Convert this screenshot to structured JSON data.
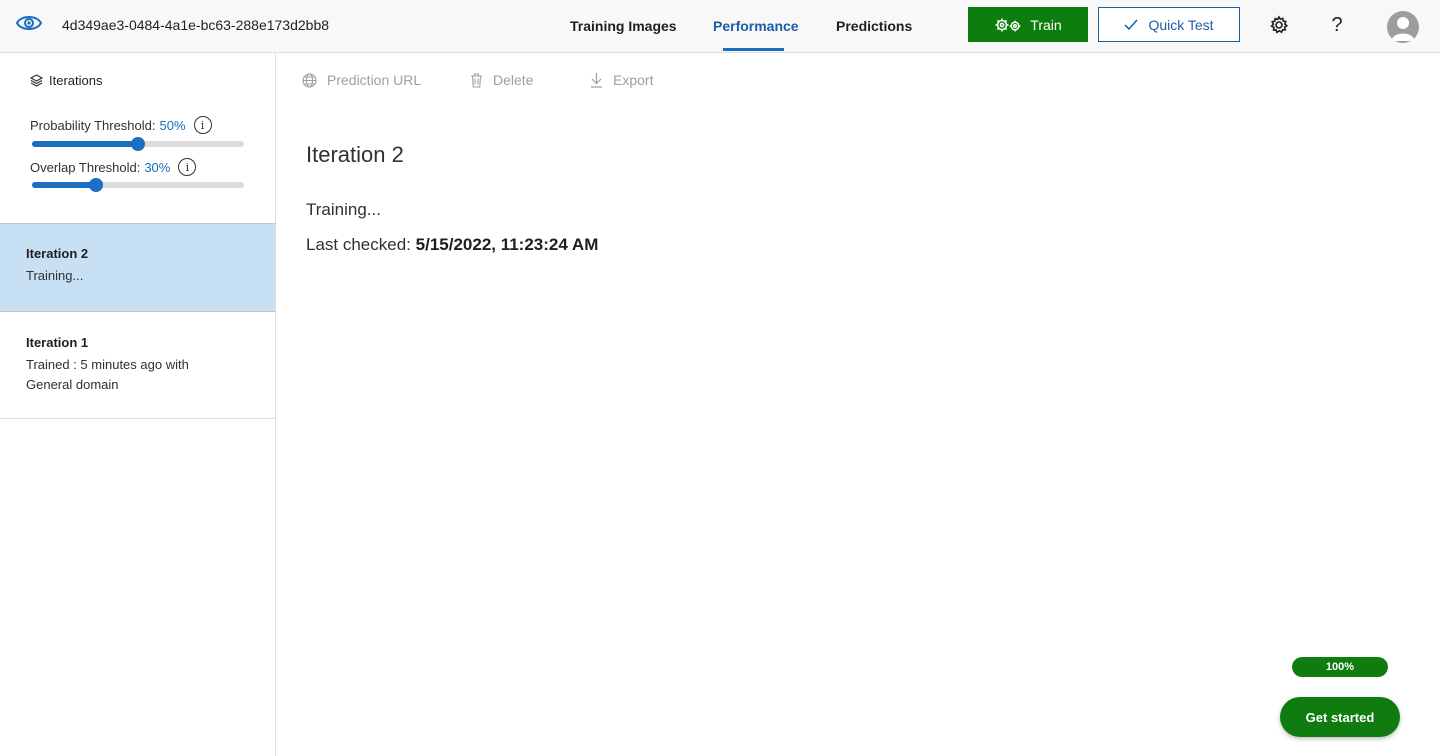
{
  "header": {
    "project_id": "4d349ae3-0484-4a1e-bc63-288e173d2bb8",
    "tabs": [
      {
        "label": "Training Images"
      },
      {
        "label": "Performance"
      },
      {
        "label": "Predictions"
      }
    ],
    "active_tab": "Performance",
    "train_label": "Train",
    "quick_test_label": "Quick Test",
    "help_glyph": "?",
    "icons": [
      "eye-icon",
      "gears-icon",
      "checkmark-icon",
      "gear-icon",
      "help-icon",
      "avatar"
    ],
    "accent_color": "#1b6ec2",
    "train_color": "#0d7d0d"
  },
  "sidebar": {
    "iterations_label": "Iterations",
    "probability": {
      "label": "Probability Threshold:",
      "value": "50%",
      "fraction": 0.5
    },
    "overlap": {
      "label": "Overlap Threshold:",
      "value": "30%",
      "fraction": 0.3
    },
    "info_glyph": "i",
    "iterations": [
      {
        "title": "Iteration 2",
        "status": "Training...",
        "selected": true
      },
      {
        "title": "Iteration 1",
        "status": "Trained : 5 minutes ago with",
        "status2": "General domain",
        "selected": false
      }
    ],
    "selected_color": "#c7e0f4"
  },
  "toolbar": {
    "prediction_url": "Prediction URL",
    "delete": "Delete",
    "export": "Export"
  },
  "main": {
    "title": "Iteration 2",
    "status": "Training...",
    "last_checked_label": "Last checked:",
    "last_checked_value": "5/15/2022, 11:23:24 AM"
  },
  "onboarding": {
    "progress_text": "100%",
    "progress_fraction": 1.0,
    "get_started_label": "Get started",
    "color": "#107c10"
  }
}
